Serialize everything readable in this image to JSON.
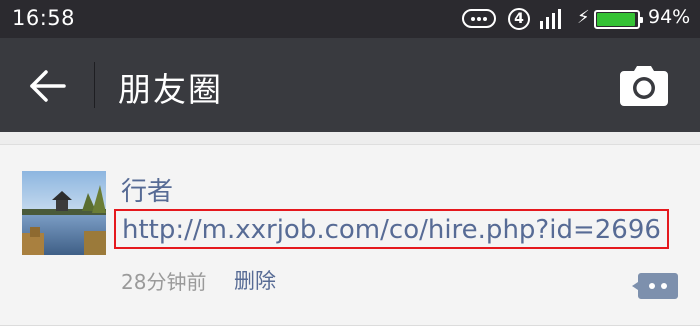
{
  "status_bar": {
    "time": "16:58",
    "sim_slot": "4",
    "battery_percent": "94%",
    "battery_level": 0.94,
    "icons": [
      "more-dots-icon",
      "sim-icon",
      "signal-icon",
      "charging-icon",
      "battery-icon"
    ]
  },
  "header": {
    "title": "朋友圈",
    "back_icon": "back-arrow-icon",
    "camera_icon": "camera-icon"
  },
  "post": {
    "author": "行者",
    "link_text": "http://m.xxrjob.com/co/hire.php?id=2696",
    "time": "28分钟前",
    "delete_label": "删除",
    "comment_icon": "comment-icon"
  },
  "colors": {
    "status_bar_bg": "#2b2a2f",
    "header_bg": "#393a3f",
    "link": "#576b95",
    "highlight_border": "#e5181d",
    "battery": "#35c235"
  }
}
